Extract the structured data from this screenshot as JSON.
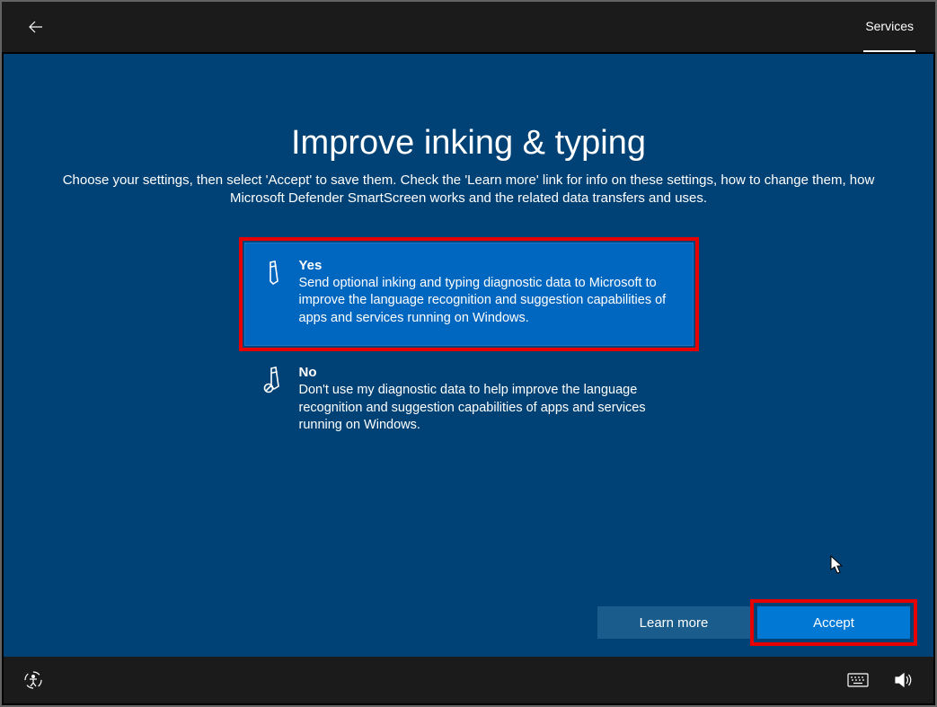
{
  "header": {
    "services_tab": "Services"
  },
  "page": {
    "title": "Improve inking & typing",
    "subtitle": "Choose your settings, then select 'Accept' to save them. Check the 'Learn more' link for info on these settings, how to change them, how Microsoft Defender SmartScreen works and the related data transfers and uses."
  },
  "options": {
    "yes": {
      "title": "Yes",
      "desc": "Send optional inking and typing diagnostic data to Microsoft to improve the language recognition and suggestion capabilities of apps and services running on Windows."
    },
    "no": {
      "title": "No",
      "desc": "Don't use my diagnostic data to help improve the language recognition and suggestion capabilities of apps and services running on Windows."
    }
  },
  "buttons": {
    "learn_more": "Learn more",
    "accept": "Accept"
  }
}
